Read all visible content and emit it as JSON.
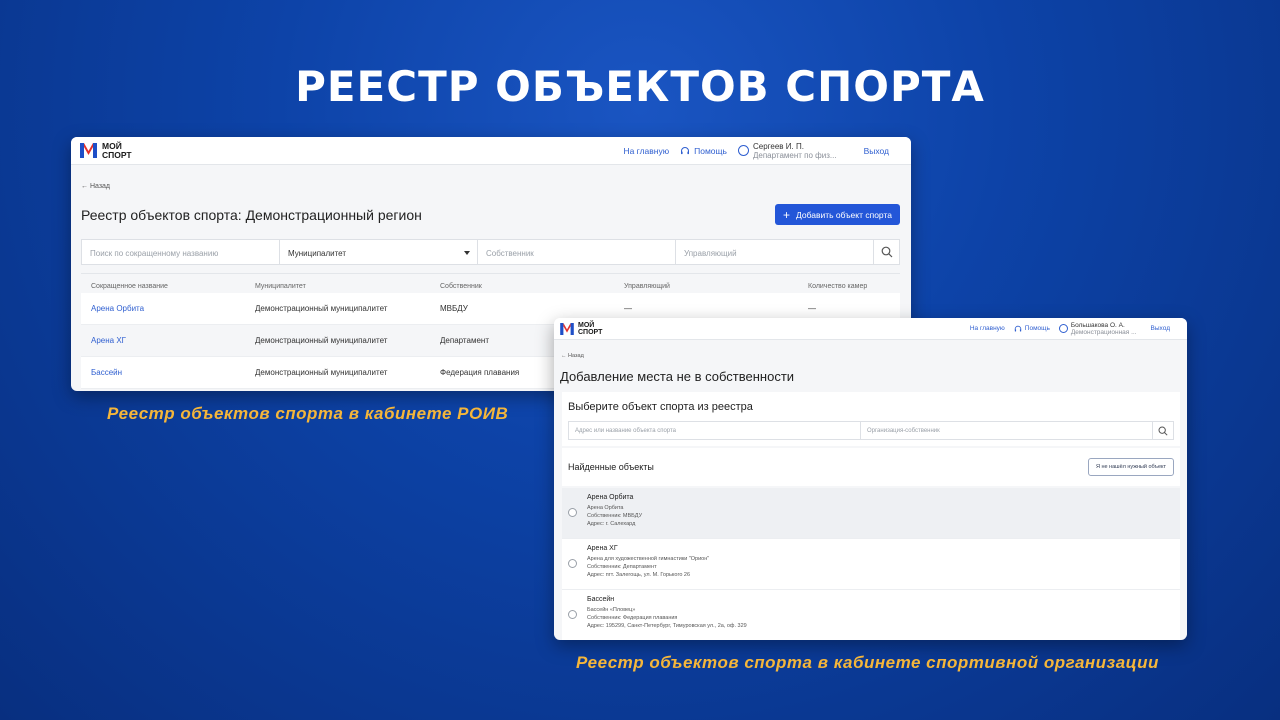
{
  "slide": {
    "title": "РЕЕСТР ОБЪЕКТОВ СПОРТА",
    "caption_left": "Реестр объектов спорта в кабинете РОИВ",
    "caption_right": "Реестр объектов спорта в кабинете спортивной организации"
  },
  "colors": {
    "background": "#0d43a8",
    "caption": "#f5b63a",
    "accent": "#2356d8",
    "link": "#2f5fd0",
    "logo_red": "#e3312d",
    "logo_blue": "#1f4fc7"
  },
  "window1": {
    "logo_line1": "МОЙ",
    "logo_line2": "СПОРТ",
    "nav_home": "На главную",
    "nav_help": "Помощь",
    "user_name": "Сергеев И. П.",
    "user_dept": "Департамент по физ...",
    "logout": "Выход",
    "back": "← Назад",
    "page_title": "Реестр объектов спорта: Демонстрационный регион",
    "add_button": "Добавить объект спорта",
    "filters": {
      "search_placeholder": "Поиск по сокращенному названию",
      "municipality": "Муниципалитет",
      "owner_placeholder": "Собственник",
      "manager_placeholder": "Управляющий"
    },
    "columns": [
      "Сокращенное название",
      "Муниципалитет",
      "Собственник",
      "Управляющий",
      "Количество камер"
    ],
    "rows": [
      {
        "name": "Арена Орбита",
        "municipality": "Демонстрационный муниципалитет",
        "owner": "МВБДУ",
        "manager": "—",
        "cameras": "—"
      },
      {
        "name": "Арена ХГ",
        "municipality": "Демонстрационный муниципалитет",
        "owner": "Департамент",
        "manager": "",
        "cameras": ""
      },
      {
        "name": "Бассейн",
        "municipality": "Демонстрационный муниципалитет",
        "owner": "Федерация плавания",
        "manager": "",
        "cameras": ""
      }
    ]
  },
  "window2": {
    "logo_line1": "МОЙ",
    "logo_line2": "СПОРТ",
    "nav_home": "На главную",
    "nav_help": "Помощь",
    "user_name": "Большакова О. А.",
    "user_dept": "Демонстрационная ...",
    "logout": "Выход",
    "back": "← Назад",
    "page_title": "Добавление места не в собственности",
    "select_title": "Выберите объект спорта из реестра",
    "address_placeholder": "Адрес или название объекта спорта",
    "org_placeholder": "Организация-собственник",
    "found_title": "Найденные объекты",
    "not_found_button": "Я не нашёл нужный объект",
    "items": [
      {
        "name": "Арена Орбита",
        "full": "Арена Орбита",
        "owner": "Собственник: МВБДУ",
        "address": "Адрес: г. Салехард"
      },
      {
        "name": "Арена ХГ",
        "full": "Арена для художественной гимнастики \"Орион\"",
        "owner": "Собственник: Департамент",
        "address": "Адрес: пгт. Залегощь, ул. М. Горького 26"
      },
      {
        "name": "Бассейн",
        "full": "Бассейн «Пловец»",
        "owner": "Собственник: Федерация плавания",
        "address": "Адрес: 195299, Санкт-Петербург, Тимуровская ул., 2а, оф. 329"
      }
    ]
  }
}
